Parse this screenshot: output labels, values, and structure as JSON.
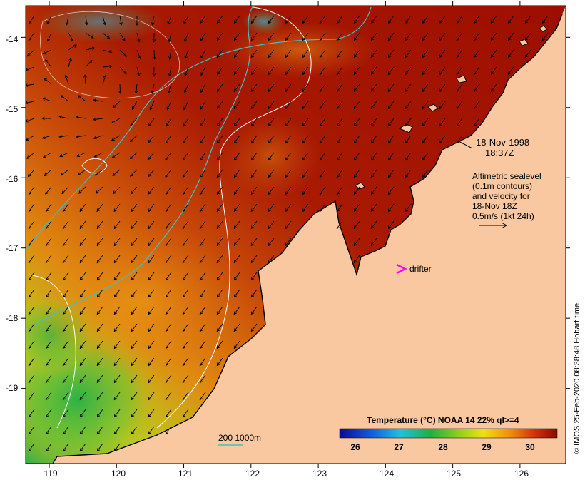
{
  "map": {
    "date_line": "18-Nov-1998",
    "time_line": "18:37Z",
    "info_lines": [
      "Altimetric sealevel",
      "(0.1m contours)",
      "and velocity for",
      "18-Nov 18Z",
      "0.5m/s (1kt 24h)"
    ],
    "drifter_label": "drifter",
    "depth_legend": "200  1000m",
    "credit": "© IMOS 25-Feb-2020 08:38:48 Hobart time",
    "colors": {
      "land": "#f9c8a0",
      "warm": "#a01000",
      "drifter": "#ff00ff",
      "isobath": "#40c0c0",
      "contour": "#ffffff"
    }
  },
  "axes": {
    "lon_ticks": [
      "119",
      "120",
      "121",
      "122",
      "123",
      "124",
      "125",
      "126"
    ],
    "lat_ticks": [
      "-14",
      "-15",
      "-16",
      "-17",
      "-18",
      "-19"
    ],
    "lon_range": [
      118.65,
      126.68
    ],
    "lat_range": [
      -20.07,
      -13.55
    ]
  },
  "colorbar": {
    "title": "Temperature (°C) NOAA 14 22% ql>=4",
    "ticks": [
      "26",
      "27",
      "28",
      "29",
      "30"
    ],
    "range": [
      25.5,
      30.5
    ]
  }
}
